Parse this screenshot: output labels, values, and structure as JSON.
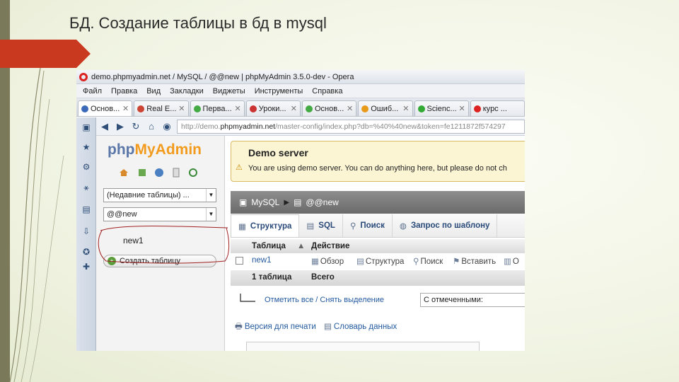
{
  "slide": {
    "title": "БД. Создание таблицы в бд в mysql"
  },
  "colors": {
    "accent_red": "#c8391f",
    "pma_blue": "#5b76a8",
    "pma_orange": "#f29b1d",
    "notice_bg": "#fbf5d4"
  },
  "browser": {
    "window_title": "demo.phpmyadmin.net / MySQL / @@new | phpMyAdmin 3.5.0-dev - Opera",
    "menu": [
      "Файл",
      "Правка",
      "Вид",
      "Закладки",
      "Виджеты",
      "Инструменты",
      "Справка"
    ],
    "tabs": [
      {
        "label": "Основ...",
        "icon": "globe-icon",
        "color": "#3d6ab8"
      },
      {
        "label": "Real E...",
        "icon": "r-icon",
        "color": "#c43"
      },
      {
        "label": "Перва...",
        "icon": "cf-icon",
        "color": "#4a4"
      },
      {
        "label": "Уроки...",
        "icon": "hand-icon",
        "color": "#c33"
      },
      {
        "label": "Основ...",
        "icon": "cf-icon",
        "color": "#4a4"
      },
      {
        "label": "Ошиб...",
        "icon": "m-icon",
        "color": "#e89a1a"
      },
      {
        "label": "Scienc...",
        "icon": "green-circle-icon",
        "color": "#3a3"
      },
      {
        "label": "курс ...",
        "icon": "yandex-icon",
        "color": "#d22"
      }
    ],
    "address_prefix": "http://demo.",
    "address_host": "phpmyadmin.net",
    "address_rest": "/master-config/index.php?db=%40%40new&token=fe1211872f574297"
  },
  "pma": {
    "logo_php": "php",
    "logo_myadmin": "MyAdmin",
    "recent_tables": "(Недавние таблицы) ...",
    "db_select": "@@new",
    "db_item": "new1",
    "create_table": "Создать таблицу",
    "notice_title": "Demo server",
    "notice_text": "You are using demo server. You can do anything here, but please do not ch",
    "crumb_server": "MySQL",
    "crumb_db": "@@new",
    "subtabs": [
      {
        "label": "Структура",
        "icon": "structure-icon"
      },
      {
        "label": "SQL",
        "icon": "sql-icon"
      },
      {
        "label": "Поиск",
        "icon": "search-icon"
      },
      {
        "label": "Запрос по шаблону",
        "icon": "query-icon"
      }
    ],
    "table": {
      "col_table": "Таблица",
      "col_action": "Действие",
      "rows": [
        {
          "name": "new1",
          "actions": [
            "Обзор",
            "Структура",
            "Поиск",
            "Вставить",
            "О"
          ]
        }
      ],
      "footer_count": "1 таблица",
      "footer_total": "Всего"
    },
    "check_all": "Отметить все / Снять выделение",
    "with_selected": "С отмеченными:",
    "print_view": "Версия для печати",
    "data_dictionary": "Словарь данных"
  }
}
